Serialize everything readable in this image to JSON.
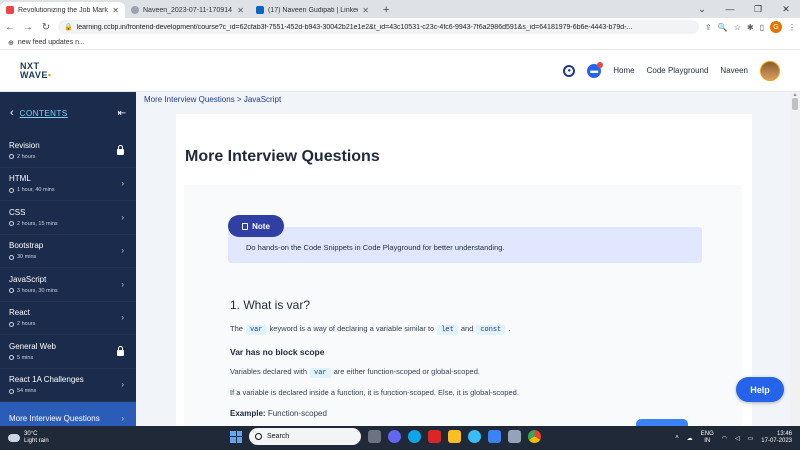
{
  "browser": {
    "tabs": [
      {
        "title": "Revolutionizing the Job Market |",
        "color": "#ef4444",
        "active": true
      },
      {
        "title": "Naveen_2023-07-11-170914",
        "color": "#9ca3af",
        "active": false
      },
      {
        "title": "(17) Naveen Gudipati | LinkedIn",
        "color": "#0a66c2",
        "active": false
      }
    ],
    "new_tab": "+",
    "url": "learning.ccbp.in/frontend-development/course?c_id=62cfab3f-7551-452d-b943-30042b21e1e2&t_id=43c10531-c23c-4fc6-9943-7f6a2986d591&s_id=64181979-6b6e-4443-b79d-...",
    "profile_initial": "G",
    "bookmark": "new feed updates n..."
  },
  "header": {
    "logo_top": "NXT",
    "logo_bottom": "WAVE",
    "nav": [
      "Home",
      "Code Playground"
    ],
    "user": "Naveen"
  },
  "sidebar": {
    "title": "CONTENTS",
    "items": [
      {
        "name": "Revision",
        "duration": "2 hours",
        "locked": true
      },
      {
        "name": "HTML",
        "duration": "1 hour, 40 mins",
        "locked": false
      },
      {
        "name": "CSS",
        "duration": "2 hours, 15 mins",
        "locked": false
      },
      {
        "name": "Bootstrap",
        "duration": "30 mins",
        "locked": false
      },
      {
        "name": "JavaScript",
        "duration": "3 hours, 30 mins",
        "locked": false
      },
      {
        "name": "React",
        "duration": "2 hours",
        "locked": false
      },
      {
        "name": "General Web",
        "duration": "5 mins",
        "locked": true
      },
      {
        "name": "React 1A Challenges",
        "duration": "54 mins",
        "locked": false
      },
      {
        "name": "More Interview Questions",
        "duration": "",
        "locked": false,
        "active": true
      }
    ]
  },
  "main": {
    "breadcrumb": "More Interview Questions > JavaScript",
    "title": "More Interview Questions",
    "note_label": "Note",
    "note_text": "Do hands-on the Code Snippets in Code Playground for better understanding.",
    "question": "1. What is var?",
    "p1": {
      "a": "The",
      "code1": "var",
      "b": "keyword is a way of declaring a variable similar to",
      "code2": "let",
      "c": "and",
      "code3": "const",
      "d": "."
    },
    "subheading": "Var has no block scope",
    "p2": {
      "a": "Variables declared with",
      "code1": "var",
      "b": "are either function-scoped or global-scoped."
    },
    "p3": "If a variable is declared inside a function, it is function-scoped. Else, it is global-scoped.",
    "example_label": "Example:",
    "example_text": "Function-scoped",
    "help": "Help"
  },
  "taskbar": {
    "temp": "30°C",
    "weather": "Light rain",
    "search": "Search",
    "lang1": "ENG",
    "lang2": "IN",
    "time": "13:46",
    "date": "17-07-2023"
  }
}
